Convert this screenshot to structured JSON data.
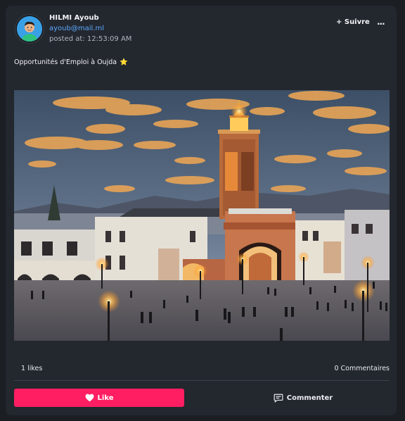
{
  "post": {
    "author_name": "HILMI Ayoub",
    "author_email": "ayoub@mail.ml",
    "posted_at": "posted at: 12:53:09 AM",
    "follow_label": "+ Suivre",
    "more_label": "...",
    "caption": "Opportunités d'Emploi à Oujda",
    "caption_emoji": "⭐",
    "image_icon": "photo-mosque-square-dusk"
  },
  "stats": {
    "likes": "1 likes",
    "comments": "0 Commentaires"
  },
  "actions": {
    "like_label": "Like",
    "comment_label": "Commenter"
  },
  "colors": {
    "background": "#1b1e23",
    "card": "#23272e",
    "accent_like": "#ff1e62",
    "link": "#5aa8ff"
  }
}
